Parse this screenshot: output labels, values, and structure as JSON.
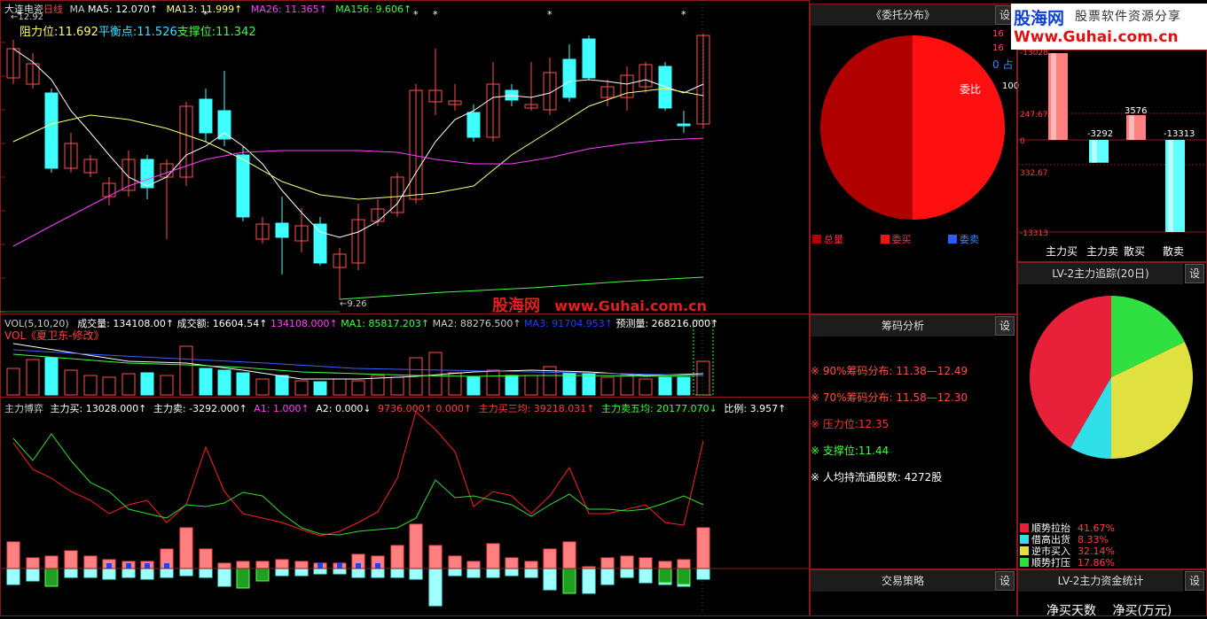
{
  "main": {
    "title": "大连电瓷",
    "period": "日线",
    "ma_header": {
      "label": "MA",
      "ma5": "MA5: 12.070↑",
      "ma13": "MA13: 11.999↑",
      "ma26": "MA26: 11.365↑",
      "ma156": "MA156: 9.606↑",
      "colors": {
        "ma5": "#ffffff",
        "ma13": "#ffff80",
        "ma26": "#ff40ff",
        "ma156": "#40ff40"
      }
    },
    "high_mark": "←12.92",
    "low_mark": "←9.26",
    "levels": {
      "resistance": "阻力位:11.692",
      "balance": "平衡点:11.526",
      "support": "支撑位:11.342"
    }
  },
  "watermark": {
    "name": "股海网",
    "url": "www.Guhai.com.cn"
  },
  "volume": {
    "header": {
      "label": "VOL(5,10,20)",
      "vol": "成交量: 134108.00↑",
      "amount": "成交额: 16604.54↑",
      "val": "134108.000↑",
      "ma1": "MA1: 85817.203↑",
      "ma2": "MA2: 88276.500↑",
      "ma3": "MA3: 91704.953↑",
      "forecast": "预测量: 268216.000↑"
    },
    "subtitle": "VOL《夏卫东-修改》"
  },
  "game": {
    "header": {
      "label": "主力博弈",
      "buy": "主力买: 13028.000↑",
      "sell": "主力卖: -3292.000↑",
      "a1": "A1: 1.000↑",
      "a2": "A2: 0.000↓",
      "v1": "9736.000↑",
      "v2": "0.000↑",
      "buy3": "主力买三均: 39218.031↑",
      "sell5": "主力卖五均: 20177.070↓",
      "ratio": "比例: 3.957↑"
    }
  },
  "panels": {
    "order_dist": {
      "title": "《委托分布》",
      "set": "设",
      "ratio_label": "委比",
      "peek": [
        "16",
        "16",
        "0 占",
        "100"
      ],
      "legend": [
        "总量",
        "委买",
        "委卖"
      ]
    },
    "chip": {
      "title": "筹码分析",
      "set": "设",
      "items": [
        {
          "mark": "※",
          "text": "90%筹码分布: 11.38—12.49",
          "color": "#ff5040"
        },
        {
          "mark": "※",
          "text": "70%筹码分布: 11.58—12.30",
          "color": "#ff5040"
        },
        {
          "mark": "※",
          "text": "压力位:12.35",
          "color": "#ff3030"
        },
        {
          "mark": "※",
          "text": "支撑位:11.44",
          "color": "#40ff40"
        },
        {
          "mark": "※",
          "text": "人均持流通股数:  4272股",
          "color": "#ffffff"
        }
      ]
    },
    "strategy": {
      "title": "交易策略",
      "set": "设"
    },
    "logo": {
      "brand": "股海网",
      "tagline": "股票软件资源分享",
      "url": "Www.Guhai.com.cn"
    },
    "flow_bars": {
      "axis": [
        "-13028",
        "247.67",
        "0",
        "332.67",
        "-13313"
      ],
      "values_labels": [
        "-3292",
        "3576",
        "-13313"
      ],
      "categories": [
        "主力买",
        "主力卖",
        "散买",
        "散卖"
      ]
    },
    "tracking": {
      "title": "LV-2主力追踪(20日)",
      "set": "设",
      "legend": [
        {
          "label": "顺势拉抬",
          "value": "41.67%",
          "color": "#e8203a"
        },
        {
          "label": "借高出货",
          "value": "8.33%",
          "color": "#30e0e8"
        },
        {
          "label": "逆市买入",
          "value": "32.14%",
          "color": "#e0e040"
        },
        {
          "label": "顺势打压",
          "value": "17.86%",
          "color": "#30e040"
        }
      ]
    },
    "capital": {
      "title": "LV-2主力资金统计",
      "set": "设",
      "cols": [
        "净买天数",
        "净买(万元)"
      ]
    }
  },
  "chart_data": [
    {
      "type": "pie",
      "title": "委托分布",
      "slices": [
        {
          "name": "总量",
          "value": 50,
          "color": "#b00000"
        },
        {
          "name": "委买",
          "value": 50,
          "color": "#ff1010"
        },
        {
          "name": "委卖",
          "value": 0,
          "color": "#2060ff"
        }
      ]
    },
    {
      "type": "bar",
      "categories": [
        "主力买",
        "主力卖",
        "散买",
        "散卖"
      ],
      "values": [
        13028,
        -3292,
        3576,
        -13313
      ]
    },
    {
      "type": "pie",
      "title": "LV-2主力追踪(20日)",
      "slices": [
        {
          "name": "顺势拉抬",
          "value": 41.67,
          "color": "#e8203a"
        },
        {
          "name": "借高出货",
          "value": 8.33,
          "color": "#30e0e8"
        },
        {
          "name": "逆市买入",
          "value": 32.14,
          "color": "#e0e040"
        },
        {
          "name": "顺势打压",
          "value": 17.86,
          "color": "#30e040"
        }
      ]
    }
  ]
}
